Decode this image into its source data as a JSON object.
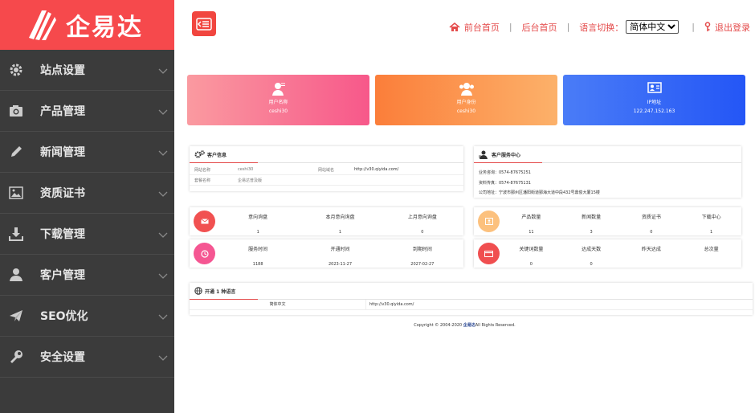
{
  "brand": {
    "name": "企易达"
  },
  "sidebar": {
    "items": [
      {
        "label": "站点设置",
        "icon": "gear-icon"
      },
      {
        "label": "产品管理",
        "icon": "camera-icon"
      },
      {
        "label": "新闻管理",
        "icon": "pencil-icon"
      },
      {
        "label": "资质证书",
        "icon": "image-icon"
      },
      {
        "label": "下载管理",
        "icon": "download-icon"
      },
      {
        "label": "客户管理",
        "icon": "user-icon"
      },
      {
        "label": "SEO优化",
        "icon": "paper-plane-icon"
      },
      {
        "label": "安全设置",
        "icon": "wrench-icon"
      }
    ]
  },
  "header": {
    "front_home": "前台首页",
    "back_home": "后台首页",
    "lang_label": "语言切换：",
    "lang_selected": "简体中文",
    "logout": "退出登录"
  },
  "stats": [
    {
      "label": "用户名称",
      "value": "ceshi30",
      "color": "#f6608a",
      "icon": "user-icon"
    },
    {
      "label": "用户身份",
      "value": "ceshi30",
      "color": "#fb8e44",
      "icon": "users-icon"
    },
    {
      "label": "IP地址",
      "value": "122.247.152.163",
      "color": "#3a6af8",
      "icon": "id-card-icon"
    }
  ],
  "customer_info": {
    "title": "客户信息",
    "site_name_label": "网站名称",
    "site_name_value": "ceshi30",
    "domain_label": "网站域名",
    "domain_value": "http://v30.qiyida.com/",
    "version_label": "套餐名称",
    "version_value": "企易达普及版"
  },
  "service_center": {
    "title": "客户服务中心",
    "hotline": "业务咨询：0574-87675251",
    "fax": "资料传真：0574-87675131",
    "address": "公司地址：宁波市鄞州区潘阳街道鄞海大道中段432号鼎俊大厦15楼"
  },
  "inquiry": {
    "cols": [
      {
        "label": "意向询盘",
        "value": "1"
      },
      {
        "label": "本月意向询盘",
        "value": "1"
      },
      {
        "label": "上月意向询盘",
        "value": "0"
      }
    ]
  },
  "service_time": {
    "cols": [
      {
        "label": "服务时间",
        "value": "1188"
      },
      {
        "label": "开通时间",
        "value": "2023-11-27"
      },
      {
        "label": "到期时间",
        "value": "2027-02-27"
      }
    ]
  },
  "content_counts": {
    "cols": [
      {
        "label": "产品数量",
        "value": "11"
      },
      {
        "label": "新闻数量",
        "value": "3"
      },
      {
        "label": "资质证书",
        "value": "0"
      },
      {
        "label": "下载中心",
        "value": "1"
      }
    ]
  },
  "keywords": {
    "cols": [
      {
        "label": "关键词数量",
        "value": "0"
      },
      {
        "label": "达成天数",
        "value": "0"
      },
      {
        "label": "昨天达成",
        "value": ""
      },
      {
        "label": "总次量",
        "value": ""
      }
    ]
  },
  "languages": {
    "title": "开通 1 种语言",
    "rows": [
      {
        "name": "简体中文",
        "url": "http://v30.qiyida.com/"
      }
    ]
  },
  "footer": {
    "prefix": "Copyright © 2004-2020 ",
    "brand": "企易达",
    "suffix": "All Rights Reserved."
  }
}
